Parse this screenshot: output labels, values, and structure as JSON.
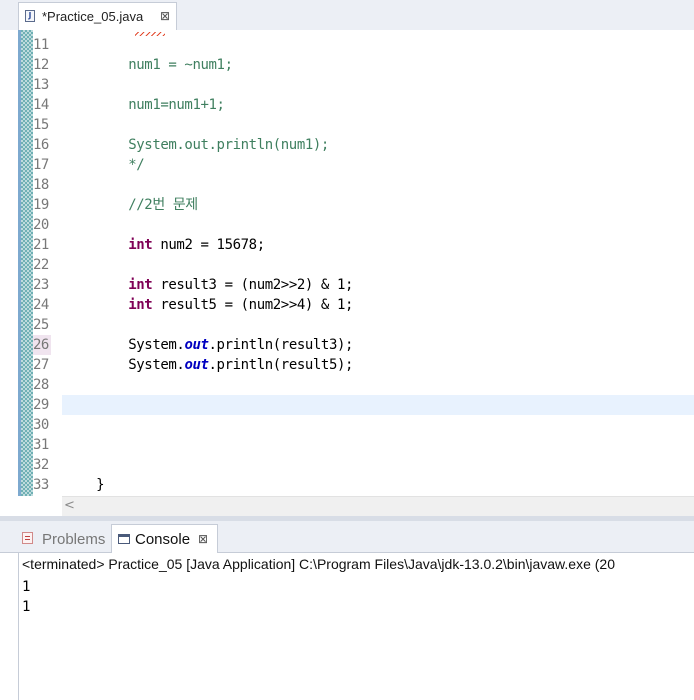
{
  "editor_tab": {
    "title": "*Practice_05.java",
    "icon": "java-file-icon",
    "close_glyph": "⊠"
  },
  "editor": {
    "lines": [
      {
        "num": "11",
        "tokens": []
      },
      {
        "num": "12",
        "tokens": [
          {
            "t": "        num1 = ~num1;",
            "c": "comment"
          }
        ]
      },
      {
        "num": "13",
        "tokens": []
      },
      {
        "num": "14",
        "tokens": [
          {
            "t": "        num1=num1+1;",
            "c": "comment"
          }
        ]
      },
      {
        "num": "15",
        "tokens": []
      },
      {
        "num": "16",
        "tokens": [
          {
            "t": "        System.out.println(num1);",
            "c": "comment"
          }
        ]
      },
      {
        "num": "17",
        "tokens": [
          {
            "t": "        */",
            "c": "comment"
          }
        ]
      },
      {
        "num": "18",
        "tokens": []
      },
      {
        "num": "19",
        "tokens": [
          {
            "t": "        //2번 문제",
            "c": "comment"
          }
        ]
      },
      {
        "num": "20",
        "tokens": []
      },
      {
        "num": "21",
        "tokens": [
          {
            "t": "        ",
            "c": ""
          },
          {
            "t": "int",
            "c": "kw"
          },
          {
            "t": " num2 = 15678;",
            "c": ""
          }
        ]
      },
      {
        "num": "22",
        "tokens": []
      },
      {
        "num": "23",
        "tokens": [
          {
            "t": "        ",
            "c": ""
          },
          {
            "t": "int",
            "c": "kw"
          },
          {
            "t": " result3 = (num2>>2) & 1;",
            "c": ""
          }
        ]
      },
      {
        "num": "24",
        "tokens": [
          {
            "t": "        ",
            "c": ""
          },
          {
            "t": "int",
            "c": "kw"
          },
          {
            "t": " result5 = (num2>>4) & 1;",
            "c": ""
          }
        ]
      },
      {
        "num": "25",
        "tokens": []
      },
      {
        "num": "26",
        "highlight": true,
        "tokens": [
          {
            "t": "        System.",
            "c": ""
          },
          {
            "t": "out",
            "c": "field"
          },
          {
            "t": ".println(result3);",
            "c": ""
          }
        ]
      },
      {
        "num": "27",
        "tokens": [
          {
            "t": "        System.",
            "c": ""
          },
          {
            "t": "out",
            "c": "field"
          },
          {
            "t": ".println(result5);",
            "c": ""
          }
        ]
      },
      {
        "num": "28",
        "tokens": []
      },
      {
        "num": "29",
        "tokens": []
      },
      {
        "num": "30",
        "tokens": []
      },
      {
        "num": "31",
        "tokens": []
      },
      {
        "num": "32",
        "tokens": []
      },
      {
        "num": "33",
        "tokens": [
          {
            "t": "    }",
            "c": ""
          }
        ]
      }
    ]
  },
  "editor_scrollbar": {
    "left_arrow": "<"
  },
  "panel": {
    "tabs": [
      {
        "label": "Problems",
        "icon": "problems-icon",
        "active": false
      },
      {
        "label": "Console",
        "icon": "console-icon",
        "active": true,
        "close_glyph": "⊠"
      }
    ],
    "console": {
      "header": "<terminated> Practice_05 [Java Application] C:\\Program Files\\Java\\jdk-13.0.2\\bin\\javaw.exe  (20",
      "output": [
        "1",
        "1"
      ]
    }
  },
  "colors": {
    "keyword": "#7f0055",
    "comment": "#3f7f5f",
    "static_field": "#0000c0",
    "variable": "#6a3e3e",
    "current_line": "#e8f2fe"
  }
}
